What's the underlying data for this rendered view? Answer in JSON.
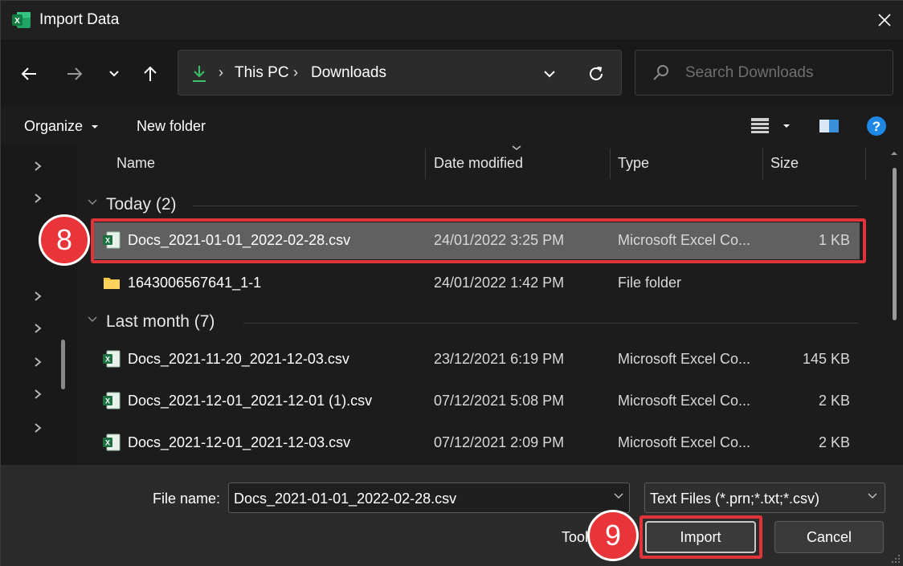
{
  "window": {
    "title": "Import Data",
    "app_icon": "excel-icon",
    "close_icon": "close-icon"
  },
  "nav": {
    "back_icon": "arrow-left-icon",
    "forward_icon": "arrow-right-icon",
    "recent_icon": "chevron-down-icon",
    "up_icon": "arrow-up-icon",
    "breadcrumb": [
      "This PC",
      "Downloads"
    ],
    "breadcrumb_separator": "›",
    "search_placeholder": "Search Downloads"
  },
  "toolbar": {
    "organize_label": "Organize",
    "new_folder_label": "New folder"
  },
  "columns": {
    "name": "Name",
    "date_modified": "Date modified",
    "type": "Type",
    "size": "Size"
  },
  "groups": [
    {
      "label": "Today (2)",
      "items": [
        {
          "name": "Docs_2021-01-01_2022-02-28.csv",
          "date": "24/01/2022 3:25 PM",
          "type": "Microsoft Excel Co...",
          "size": "1 KB",
          "icon": "excel-csv-icon",
          "selected": true
        },
        {
          "name": "1643006567641_1-1",
          "date": "24/01/2022 1:42 PM",
          "type": "File folder",
          "size": "",
          "icon": "folder-icon",
          "selected": false
        }
      ]
    },
    {
      "label": "Last month (7)",
      "items": [
        {
          "name": "Docs_2021-11-20_2021-12-03.csv",
          "date": "23/12/2021 6:19 PM",
          "type": "Microsoft Excel Co...",
          "size": "145 KB",
          "icon": "excel-csv-icon",
          "selected": false
        },
        {
          "name": "Docs_2021-12-01_2021-12-01 (1).csv",
          "date": "07/12/2021 5:08 PM",
          "type": "Microsoft Excel Co...",
          "size": "2 KB",
          "icon": "excel-csv-icon",
          "selected": false
        },
        {
          "name": "Docs_2021-12-01_2021-12-03.csv",
          "date": "07/12/2021 2:09 PM",
          "type": "Microsoft Excel Co...",
          "size": "2 KB",
          "icon": "excel-csv-icon",
          "selected": false
        }
      ]
    }
  ],
  "footer": {
    "file_name_label": "File name:",
    "file_name_value": "Docs_2021-01-01_2022-02-28.csv",
    "file_type_value": "Text Files (*.prn;*.txt;*.csv)",
    "tools_label": "Tools",
    "import_label": "Import",
    "cancel_label": "Cancel"
  },
  "annotations": {
    "step_a": "8",
    "step_b": "9",
    "highlight_color": "#e0343a"
  },
  "colors": {
    "accent": "#0078d4",
    "excel_green": "#1d6f42",
    "folder_yellow": "#f4c542",
    "selected_row": "#606060"
  }
}
